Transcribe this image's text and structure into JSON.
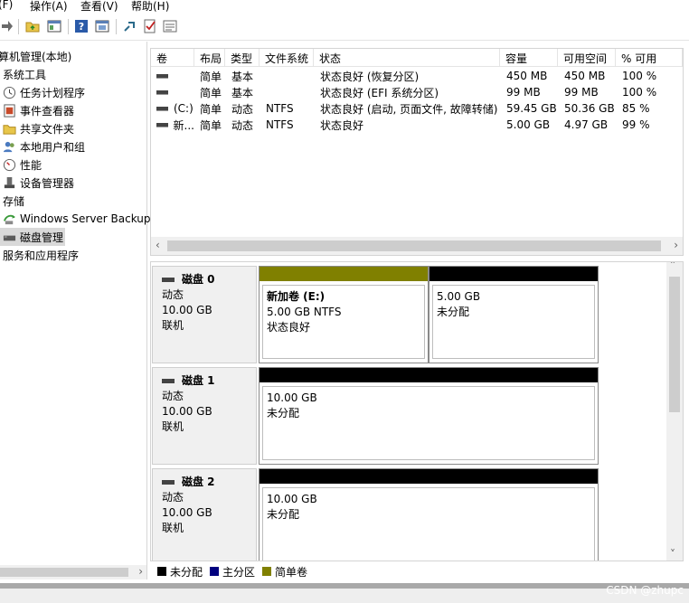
{
  "menu": {
    "file": "(F)",
    "action": "操作(A)",
    "view": "查看(V)",
    "help": "帮助(H)"
  },
  "toolbar": {
    "icons": [
      "forward-icon",
      "up-folder-icon",
      "show-hide-tree-icon",
      "help-icon",
      "console-icon",
      "connect-icon",
      "check-icon",
      "properties-icon"
    ]
  },
  "tree": {
    "root": "算机管理(本地)",
    "system_tools": "系统工具",
    "task_scheduler": "任务计划程序",
    "event_viewer": "事件查看器",
    "shared_folders": "共享文件夹",
    "local_users": "本地用户和组",
    "performance": "性能",
    "device_manager": "设备管理器",
    "storage": "存储",
    "windows_backup": "Windows Server Backup",
    "disk_management": "磁盘管理",
    "services_apps": "服务和应用程序"
  },
  "volume_table": {
    "columns": [
      "卷",
      "布局",
      "类型",
      "文件系统",
      "状态",
      "容量",
      "可用空间",
      "% 可用"
    ],
    "rows": [
      {
        "volume": "",
        "layout": "简单",
        "type": "基本",
        "fs": "",
        "status": "状态良好 (恢复分区)",
        "capacity": "450 MB",
        "free": "450 MB",
        "pct": "100 %"
      },
      {
        "volume": "",
        "layout": "简单",
        "type": "基本",
        "fs": "",
        "status": "状态良好 (EFI 系统分区)",
        "capacity": "99 MB",
        "free": "99 MB",
        "pct": "100 %"
      },
      {
        "volume": "(C:)",
        "layout": "简单",
        "type": "动态",
        "fs": "NTFS",
        "status": "状态良好 (启动, 页面文件, 故障转储)",
        "capacity": "59.45 GB",
        "free": "50.36 GB",
        "pct": "85 %"
      },
      {
        "volume": "新...",
        "layout": "简单",
        "type": "动态",
        "fs": "NTFS",
        "status": "状态良好",
        "capacity": "5.00 GB",
        "free": "4.97 GB",
        "pct": "99 %"
      }
    ]
  },
  "disks": [
    {
      "name": "磁盘 0",
      "kind": "动态",
      "size": "10.00 GB",
      "state": "联机",
      "partitions": [
        {
          "title": "新加卷 (E:)",
          "line1": "5.00 GB NTFS",
          "line2": "状态良好",
          "bar_color": "#808000"
        },
        {
          "title": "",
          "line1": "5.00 GB",
          "line2": "未分配",
          "bar_color": "#000000"
        }
      ]
    },
    {
      "name": "磁盘 1",
      "kind": "动态",
      "size": "10.00 GB",
      "state": "联机",
      "partitions": [
        {
          "title": "",
          "line1": "10.00 GB",
          "line2": "未分配",
          "bar_color": "#000000"
        }
      ]
    },
    {
      "name": "磁盘 2",
      "kind": "动态",
      "size": "10.00 GB",
      "state": "联机",
      "partitions": [
        {
          "title": "",
          "line1": "10.00 GB",
          "line2": "未分配",
          "bar_color": "#000000"
        }
      ]
    }
  ],
  "legend": [
    {
      "label": "未分配",
      "color": "#000000"
    },
    {
      "label": "主分区",
      "color": "#00007f"
    },
    {
      "label": "简单卷",
      "color": "#808000"
    }
  ],
  "watermark": "CSDN @zhupc"
}
